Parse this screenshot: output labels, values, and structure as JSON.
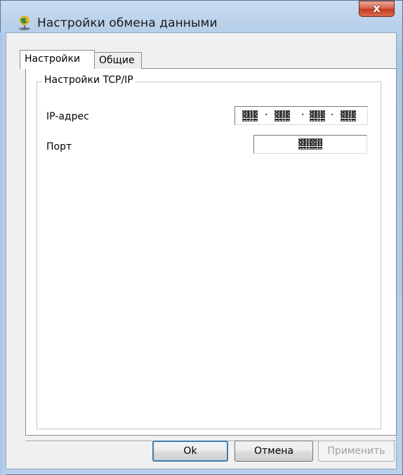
{
  "window": {
    "title": "Настройки обмена данными",
    "close_label": "x"
  },
  "tabs": [
    {
      "label": "Настройки",
      "active": true
    },
    {
      "label": "Общие",
      "active": false
    }
  ],
  "group": {
    "title": "Настройки TCP/IP"
  },
  "fields": {
    "ip_label": "IP-адрес",
    "ip_separator": "·",
    "port_label": "Порт"
  },
  "buttons": {
    "ok": "Ok",
    "cancel": "Отмена",
    "apply": "Применить"
  },
  "colors": {
    "frame": "#b9d1ea",
    "close": "#c43b1e",
    "default_button_border": "#3c7fb1"
  }
}
